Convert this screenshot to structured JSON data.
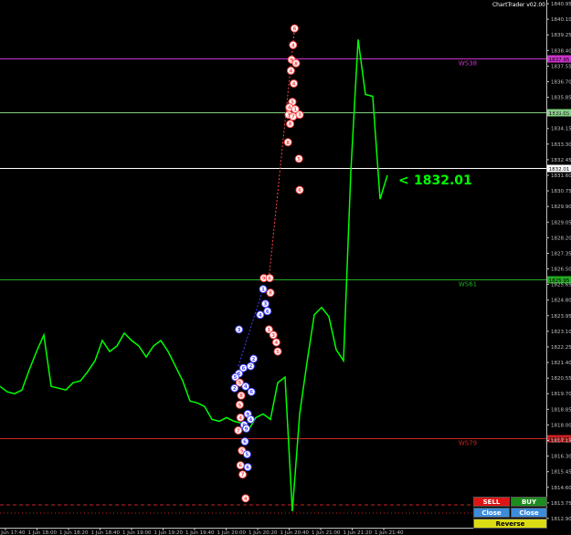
{
  "app": {
    "indicator_label": "ChartTrader v02.00"
  },
  "colors": {
    "background": "#000000",
    "price_line": "#00ff00",
    "ws38": "#cc33cc",
    "ws61": "#22aa22",
    "ws79": "#cc2222",
    "current": "#ffffff",
    "axis_text": "#c0c0c0",
    "big_label": "#00ff00"
  },
  "price_label": {
    "arrow": "<",
    "value": "1832.01"
  },
  "buttons": {
    "sell": {
      "label": "SELL",
      "color": "#e01414"
    },
    "buy": {
      "label": "BUY",
      "color": "#1e8c1e"
    },
    "close_sell": {
      "label": "Close Sell",
      "color": "#3c8cdc"
    },
    "close_buy": {
      "label": "Close Buy",
      "color": "#3c8cdc"
    },
    "reverse": {
      "label": "Reverse",
      "color": "#dcdc14"
    }
  },
  "chart_data": {
    "type": "line",
    "ylim": [
      1812.4,
      1841.15
    ],
    "yticks": [
      "1840.95",
      "1840.10",
      "1839.25",
      "1838.40",
      "1837.55",
      "1836.70",
      "1835.85",
      "1835.00",
      "1834.15",
      "1833.30",
      "1832.45",
      "1831.60",
      "1830.75",
      "1829.90",
      "1829.05",
      "1828.20",
      "1827.35",
      "1826.50",
      "1825.65",
      "1824.80",
      "1823.95",
      "1823.10",
      "1822.25",
      "1821.40",
      "1820.55",
      "1819.70",
      "1818.85",
      "1818.00",
      "1817.15",
      "1816.30",
      "1815.45",
      "1814.60",
      "1813.75",
      "1812.90"
    ],
    "xticks": [
      "1 Jun 17:40",
      "1 Jun 18:00",
      "1 Jun 18:20",
      "1 Jun 18:40",
      "1 Jun 19:00",
      "1 Jun 19:20",
      "1 Jun 19:40",
      "1 Jun 20:00",
      "1 Jun 20:20",
      "1 Jun 20:40",
      "1 Jun 21:00",
      "1 Jun 21:20",
      "1 Jun 21:40"
    ],
    "series": [
      {
        "values": [
          1820.1,
          1819.8,
          1819.7,
          1819.9,
          1821.0,
          1822.0,
          1822.9,
          1820.1,
          1820.0,
          1819.9,
          1820.3,
          1820.4,
          1820.9,
          1821.5,
          1822.6,
          1822.0,
          1822.3,
          1823.0,
          1822.6,
          1822.3,
          1821.7,
          1822.3,
          1822.6,
          1822.0,
          1821.2,
          1820.4,
          1819.3,
          1819.2,
          1819.0,
          1818.3,
          1818.2,
          1818.4,
          1818.2,
          1818.1,
          1817.7,
          1818.4,
          1818.6,
          1818.3,
          1820.3,
          1820.6,
          1813.3,
          1818.6,
          1821.4,
          1824.0,
          1824.4,
          1823.9,
          1822.1,
          1821.5,
          1831.8,
          1839.0,
          1836.0,
          1835.9,
          1830.3,
          1831.6
        ]
      }
    ],
    "levels": [
      {
        "label": "WS38",
        "value": 1837.95,
        "tag": "1837.95",
        "color": "#cc33cc"
      },
      {
        "label": "",
        "value": 1835.05,
        "tag": "1835.05",
        "color": "#7fd07f"
      },
      {
        "label": "",
        "value": 1832.01,
        "tag": "1832.01",
        "color": "#ffffff"
      },
      {
        "label": "WS61",
        "value": 1825.95,
        "tag": "1825.95",
        "color": "#22aa22"
      },
      {
        "label": "WS79",
        "value": 1817.25,
        "tag": "1817.25",
        "color": "#cc2222"
      }
    ],
    "markers": [
      {
        "x": 40.3,
        "y": 1839.6,
        "n": "6",
        "c": "#ff4444"
      },
      {
        "x": 40.1,
        "y": 1838.7,
        "n": "4",
        "c": "#ff4444"
      },
      {
        "x": 39.9,
        "y": 1837.9,
        "n": "9",
        "c": "#ff4444"
      },
      {
        "x": 40.5,
        "y": 1837.7,
        "n": "8",
        "c": "#ff4444"
      },
      {
        "x": 39.8,
        "y": 1837.3,
        "n": "4",
        "c": "#ff4444"
      },
      {
        "x": 40.2,
        "y": 1836.6,
        "n": "4",
        "c": "#ff4444"
      },
      {
        "x": 40.0,
        "y": 1835.6,
        "n": "5",
        "c": "#ff4444"
      },
      {
        "x": 39.6,
        "y": 1835.3,
        "n": "4",
        "c": "#ff4444"
      },
      {
        "x": 40.4,
        "y": 1835.2,
        "n": "1",
        "c": "#ff4444"
      },
      {
        "x": 39.5,
        "y": 1834.9,
        "n": "3",
        "c": "#ff4444"
      },
      {
        "x": 40.1,
        "y": 1834.8,
        "n": "7",
        "c": "#ff4444"
      },
      {
        "x": 41.0,
        "y": 1834.9,
        "n": "3",
        "c": "#ff4444"
      },
      {
        "x": 39.7,
        "y": 1834.4,
        "n": "8",
        "c": "#ff4444"
      },
      {
        "x": 39.4,
        "y": 1833.4,
        "n": "8",
        "c": "#ff4444"
      },
      {
        "x": 40.9,
        "y": 1832.5,
        "n": "5",
        "c": "#ff4444"
      },
      {
        "x": 41.0,
        "y": 1830.8,
        "n": "6",
        "c": "#ff4444"
      },
      {
        "x": 36.1,
        "y": 1826.0,
        "n": "9",
        "c": "#ff4444"
      },
      {
        "x": 36.9,
        "y": 1826.0,
        "n": "6",
        "c": "#ff4444"
      },
      {
        "x": 36.0,
        "y": 1825.4,
        "n": "1",
        "c": "#4444ff"
      },
      {
        "x": 37.0,
        "y": 1825.2,
        "n": "8",
        "c": "#ff4444"
      },
      {
        "x": 36.3,
        "y": 1824.6,
        "n": "3",
        "c": "#4444ff"
      },
      {
        "x": 36.6,
        "y": 1824.2,
        "n": "6",
        "c": "#4444ff"
      },
      {
        "x": 35.6,
        "y": 1824.0,
        "n": "4",
        "c": "#4444ff"
      },
      {
        "x": 32.7,
        "y": 1823.2,
        "n": "3",
        "c": "#4444ff"
      },
      {
        "x": 36.8,
        "y": 1823.2,
        "n": "1",
        "c": "#ff4444"
      },
      {
        "x": 37.4,
        "y": 1822.9,
        "n": "3",
        "c": "#ff4444"
      },
      {
        "x": 37.8,
        "y": 1822.5,
        "n": "4",
        "c": "#ff4444"
      },
      {
        "x": 38.0,
        "y": 1822.0,
        "n": "5",
        "c": "#ff4444"
      },
      {
        "x": 34.7,
        "y": 1821.6,
        "n": "2",
        "c": "#4444ff"
      },
      {
        "x": 34.3,
        "y": 1821.2,
        "n": "2",
        "c": "#4444ff"
      },
      {
        "x": 33.3,
        "y": 1821.1,
        "n": "6",
        "c": "#4444ff"
      },
      {
        "x": 32.7,
        "y": 1820.8,
        "n": "6",
        "c": "#4444ff"
      },
      {
        "x": 32.2,
        "y": 1820.6,
        "n": "5",
        "c": "#4444ff"
      },
      {
        "x": 32.8,
        "y": 1820.3,
        "n": "5",
        "c": "#ff4444"
      },
      {
        "x": 32.1,
        "y": 1820.0,
        "n": "2",
        "c": "#4444ff"
      },
      {
        "x": 33.0,
        "y": 1819.6,
        "n": "8",
        "c": "#ff4444"
      },
      {
        "x": 33.6,
        "y": 1820.1,
        "n": "4",
        "c": "#4444ff"
      },
      {
        "x": 34.4,
        "y": 1819.8,
        "n": "6",
        "c": "#4444ff"
      },
      {
        "x": 32.8,
        "y": 1819.1,
        "n": "5",
        "c": "#ff4444"
      },
      {
        "x": 32.9,
        "y": 1818.4,
        "n": "4",
        "c": "#ff4444"
      },
      {
        "x": 33.9,
        "y": 1818.6,
        "n": "9",
        "c": "#4444ff"
      },
      {
        "x": 34.3,
        "y": 1818.3,
        "n": "4",
        "c": "#4444ff"
      },
      {
        "x": 33.4,
        "y": 1818.0,
        "n": "8",
        "c": "#4444ff"
      },
      {
        "x": 33.7,
        "y": 1817.8,
        "n": "9",
        "c": "#4444ff"
      },
      {
        "x": 32.6,
        "y": 1817.7,
        "n": "7",
        "c": "#ff4444"
      },
      {
        "x": 33.5,
        "y": 1817.1,
        "n": "6",
        "c": "#4444ff"
      },
      {
        "x": 33.1,
        "y": 1816.6,
        "n": "5",
        "c": "#ff4444"
      },
      {
        "x": 33.8,
        "y": 1816.4,
        "n": "5",
        "c": "#4444ff"
      },
      {
        "x": 32.9,
        "y": 1815.8,
        "n": "6",
        "c": "#ff4444"
      },
      {
        "x": 33.9,
        "y": 1815.7,
        "n": "6",
        "c": "#4444ff"
      },
      {
        "x": 33.2,
        "y": 1815.3,
        "n": "7",
        "c": "#ff4444"
      },
      {
        "x": 33.6,
        "y": 1814.0,
        "n": "4",
        "c": "#ff4444"
      }
    ]
  }
}
